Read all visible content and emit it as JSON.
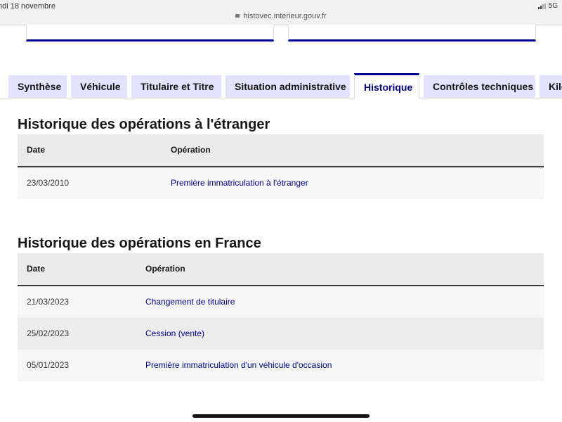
{
  "statusbar": {
    "date": "ndi 18 novembre",
    "url": "histovec.interieur.gouv.fr",
    "network": "5G",
    "signal_bars": 2
  },
  "tabs": [
    {
      "label": "Synthèse",
      "active": false
    },
    {
      "label": "Véhicule",
      "active": false
    },
    {
      "label": "Titulaire et Titre",
      "active": false
    },
    {
      "label": "Situation administrative",
      "active": false
    },
    {
      "label": "Historique",
      "active": true
    },
    {
      "label": "Contrôles techniques",
      "active": false
    },
    {
      "label": "Kilo",
      "active": false
    }
  ],
  "sections": [
    {
      "title": "Historique des opérations à l'étranger",
      "headers": {
        "date": "Date",
        "operation": "Opération"
      },
      "rows": [
        {
          "date": "23/03/2010",
          "operation": "Première immatriculation à l'étranger"
        }
      ]
    },
    {
      "title": "Historique des opérations en France",
      "headers": {
        "date": "Date",
        "operation": "Opération"
      },
      "rows": [
        {
          "date": "21/03/2023",
          "operation": "Changement de titulaire"
        },
        {
          "date": "25/02/2023",
          "operation": "Cession (vente)"
        },
        {
          "date": "05/01/2023",
          "operation": "Première immatriculation d'un véhicule d'occasion"
        }
      ]
    }
  ],
  "colors": {
    "accent": "#000091",
    "tab_bg": "#e3e3fd",
    "header_bg": "#ebebeb"
  }
}
